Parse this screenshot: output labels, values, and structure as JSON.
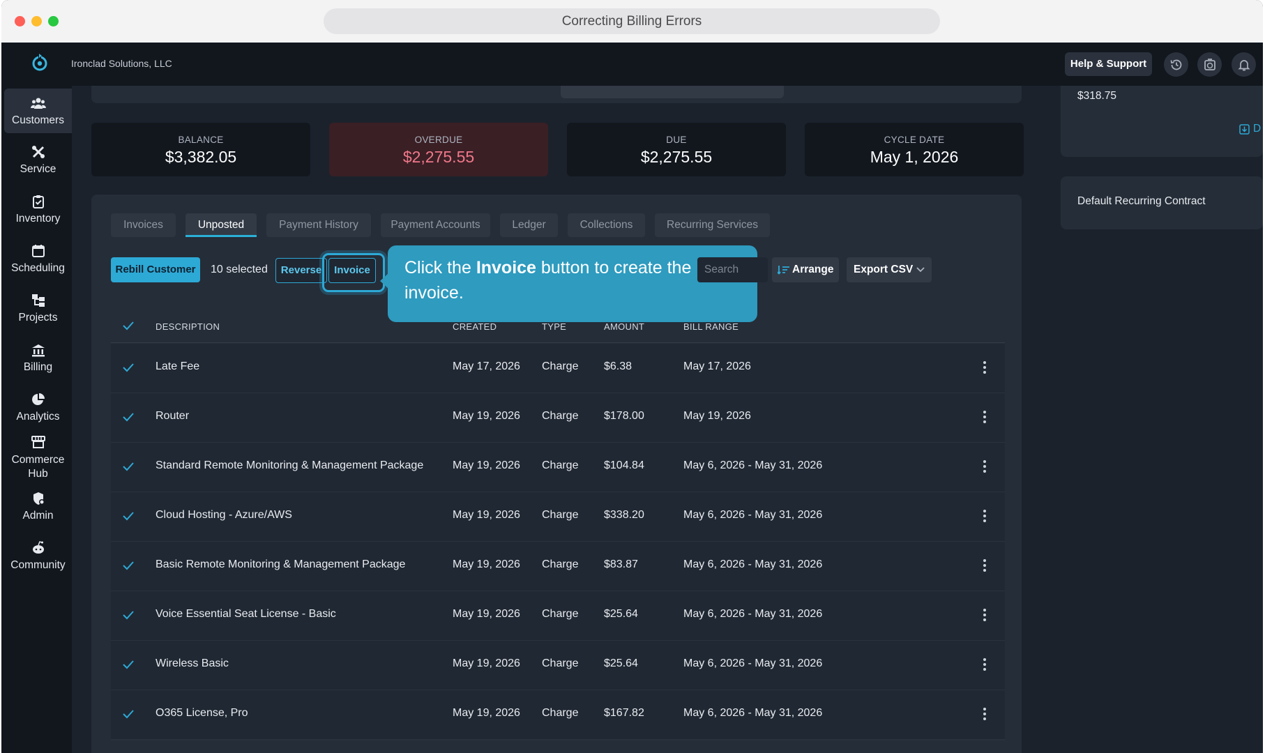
{
  "window": {
    "title": "Correcting Billing Errors"
  },
  "header": {
    "company": "Ironclad Solutions, LLC",
    "help_label": "Help & Support",
    "icons": [
      "history-icon",
      "timer-icon",
      "bell-icon"
    ]
  },
  "sidebar": {
    "items": [
      {
        "label": "Customers",
        "icon": "customers-icon",
        "active": true
      },
      {
        "label": "Service",
        "icon": "service-tools-icon"
      },
      {
        "label": "Inventory",
        "icon": "inventory-icon"
      },
      {
        "label": "Scheduling",
        "icon": "calendar-icon"
      },
      {
        "label": "Projects",
        "icon": "projects-icon"
      },
      {
        "label": "Billing",
        "icon": "bank-icon"
      },
      {
        "label": "Analytics",
        "icon": "pie-chart-icon"
      },
      {
        "label": "Commerce Hub",
        "icon": "storefront-icon"
      },
      {
        "label": "Admin",
        "icon": "admin-shield-icon"
      },
      {
        "label": "Community",
        "icon": "community-icon"
      }
    ]
  },
  "stats": [
    {
      "label": "BALANCE",
      "value": "$3,382.05"
    },
    {
      "label": "OVERDUE",
      "value": "$2,275.55"
    },
    {
      "label": "DUE",
      "value": "$2,275.55"
    },
    {
      "label": "CYCLE DATE",
      "value": "May 1, 2026"
    }
  ],
  "tabs": [
    {
      "label": "Invoices"
    },
    {
      "label": "Unposted",
      "active": true
    },
    {
      "label": "Payment History"
    },
    {
      "label": "Payment Accounts"
    },
    {
      "label": "Ledger"
    },
    {
      "label": "Collections"
    },
    {
      "label": "Recurring Services"
    }
  ],
  "toolbar": {
    "rebill_label": "Rebill Customer",
    "selected_text": "10 selected",
    "reverse_label": "Reverse",
    "invoice_label": "Invoice",
    "search_placeholder": "Search",
    "arrange_label": "Arrange",
    "export_label": "Export CSV"
  },
  "callout": {
    "pre": "Click the ",
    "bold": "Invoice",
    "post": " button to create the invoice."
  },
  "table": {
    "headers": {
      "description": "DESCRIPTION",
      "created": "CREATED",
      "type": "TYPE",
      "amount": "AMOUNT",
      "bill_range": "BILL RANGE"
    },
    "rows": [
      {
        "description": "Late Fee",
        "created": "May 17, 2026",
        "type": "Charge",
        "amount": "$6.38",
        "bill_range": "May 17, 2026"
      },
      {
        "description": "Router",
        "created": "May 19, 2026",
        "type": "Charge",
        "amount": "$178.00",
        "bill_range": "May 19, 2026"
      },
      {
        "description": "Standard Remote Monitoring & Management Package",
        "created": "May 19, 2026",
        "type": "Charge",
        "amount": "$104.84",
        "bill_range": "May 6, 2026 - May 31, 2026"
      },
      {
        "description": "Cloud Hosting - Azure/AWS",
        "created": "May 19, 2026",
        "type": "Charge",
        "amount": "$338.20",
        "bill_range": "May 6, 2026 - May 31, 2026"
      },
      {
        "description": "Basic Remote Monitoring & Management Package",
        "created": "May 19, 2026",
        "type": "Charge",
        "amount": "$83.87",
        "bill_range": "May 6, 2026 - May 31, 2026"
      },
      {
        "description": "Voice Essential Seat License - Basic",
        "created": "May 19, 2026",
        "type": "Charge",
        "amount": "$25.64",
        "bill_range": "May 6, 2026 - May 31, 2026"
      },
      {
        "description": "Wireless Basic",
        "created": "May 19, 2026",
        "type": "Charge",
        "amount": "$25.64",
        "bill_range": "May 6, 2026 - May 31, 2026"
      },
      {
        "description": "O365 License, Pro",
        "created": "May 19, 2026",
        "type": "Charge",
        "amount": "$167.82",
        "bill_range": "May 6, 2026 - May 31, 2026"
      }
    ]
  },
  "right_panel": {
    "amount": "$318.75",
    "contract": "Default Recurring Contract",
    "link_fragment": "D"
  },
  "colors": {
    "accent": "#2da9d6",
    "overdue": "#f07889",
    "background": "#1b222c"
  }
}
